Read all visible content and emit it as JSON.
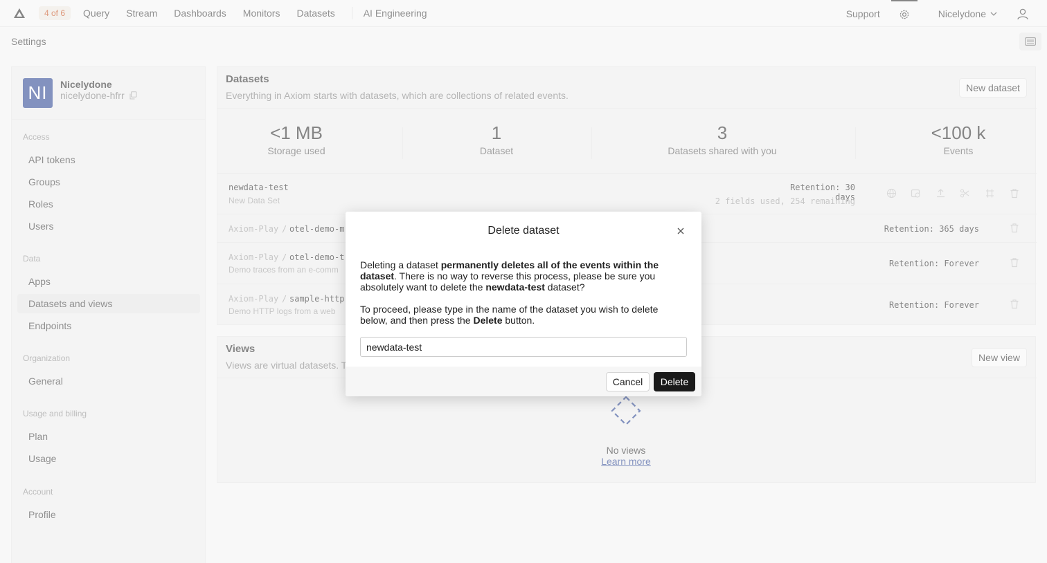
{
  "topnav": {
    "counter_badge": "4 of 6",
    "items": [
      "Query",
      "Stream",
      "Dashboards",
      "Monitors",
      "Datasets",
      "AI Engineering"
    ],
    "support": "Support",
    "org_menu": "Nicelydone"
  },
  "settings_title": "Settings",
  "sidebar": {
    "org": {
      "initials": "NI",
      "name": "Nicelydone",
      "slug": "nicelydone-hfrr",
      "avatar_color": "#1e3a8a"
    },
    "sections": [
      {
        "title": "Access",
        "items": [
          "API tokens",
          "Groups",
          "Roles",
          "Users"
        ]
      },
      {
        "title": "Data",
        "items": [
          "Apps",
          "Datasets and views",
          "Endpoints"
        ]
      },
      {
        "title": "Organization",
        "items": [
          "General"
        ]
      },
      {
        "title": "Usage and billing",
        "items": [
          "Plan",
          "Usage"
        ]
      },
      {
        "title": "Account",
        "items": [
          "Profile"
        ]
      }
    ],
    "active_item": "Datasets and views"
  },
  "datasets": {
    "title": "Datasets",
    "subtitle": "Everything in Axiom starts with datasets, which are collections of related events.",
    "new_button": "New dataset",
    "stats": [
      {
        "value": "<1 MB",
        "label": "Storage used"
      },
      {
        "value": "1",
        "label": "Dataset"
      },
      {
        "value": "3",
        "label": "Datasets shared with you"
      },
      {
        "value": "<100 k",
        "label": "Events"
      }
    ],
    "rows": [
      {
        "name": "newdata-test",
        "description": "New Data Set",
        "retention": "Retention: 30 days",
        "fields": "2 fields used, 254 remaining"
      },
      {
        "prefix": "Axiom-Play",
        "sep": "/",
        "name": "otel-demo-m",
        "retention": "Retention: 365 days"
      },
      {
        "prefix": "Axiom-Play",
        "sep": "/",
        "name": "otel-demo-t",
        "description": "Demo traces from an e-comm",
        "retention": "Retention: Forever"
      },
      {
        "prefix": "Axiom-Play",
        "sep": "/",
        "name": "sample-http",
        "description": "Demo HTTP logs from a web",
        "retention": "Retention: Forever"
      }
    ]
  },
  "views": {
    "title": "Views",
    "subtitle": "Views are virtual datasets. T",
    "new_button": "New view",
    "empty_title": "No views",
    "learn_more": "Learn more"
  },
  "modal": {
    "title": "Delete dataset",
    "p1_a": "Deleting a dataset ",
    "p1_b": "permanently deletes all of the events within the dataset",
    "p1_c": ". There is no way to reverse this process, please be sure you absolutely want to delete the ",
    "p1_d": "newdata-test",
    "p1_e": " dataset?",
    "p2_a": "To proceed, please type in the name of the dataset you wish to delete below, and then press the ",
    "p2_b": "Delete",
    "p2_c": " button.",
    "input_value": "newdata-test",
    "cancel": "Cancel",
    "delete": "Delete"
  }
}
